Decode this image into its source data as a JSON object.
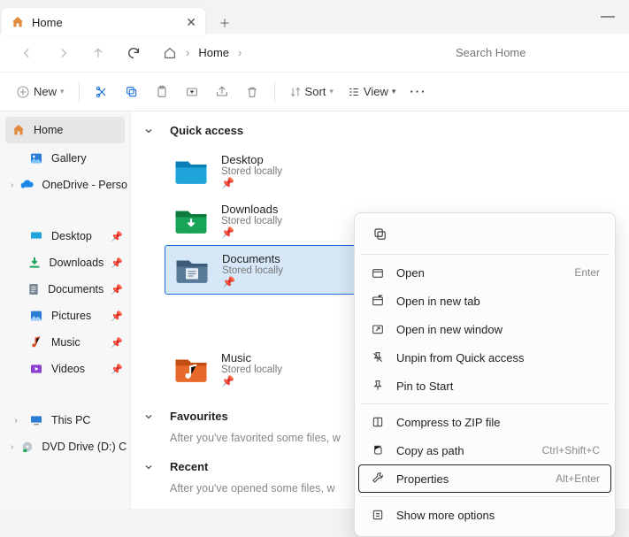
{
  "titlebar": {
    "tab_label": "Home"
  },
  "nav": {
    "breadcrumb": "Home",
    "search_placeholder": "Search Home"
  },
  "toolbar": {
    "new_label": "New",
    "sort_label": "Sort",
    "view_label": "View"
  },
  "sidebar": {
    "home": "Home",
    "gallery": "Gallery",
    "onedrive": "OneDrive - Perso",
    "desktop": "Desktop",
    "downloads": "Downloads",
    "documents": "Documents",
    "pictures": "Pictures",
    "music": "Music",
    "videos": "Videos",
    "thispc": "This PC",
    "dvd": "DVD Drive (D:) C"
  },
  "sections": {
    "quick_access": "Quick access",
    "favourites": "Favourites",
    "favourites_hint": "After you've favorited some files, w",
    "recent": "Recent",
    "recent_hint": "After you've opened some files, w"
  },
  "tiles": {
    "desktop": {
      "name": "Desktop",
      "sub": "Stored locally"
    },
    "downloads": {
      "name": "Downloads",
      "sub": "Stored locally"
    },
    "documents": {
      "name": "Documents",
      "sub": "Stored locally"
    },
    "music": {
      "name": "Music",
      "sub": "Stored locally"
    }
  },
  "ctx": {
    "open": "Open",
    "open_shortcut": "Enter",
    "open_new_tab": "Open in new tab",
    "open_new_window": "Open in new window",
    "unpin": "Unpin from Quick access",
    "pin_start": "Pin to Start",
    "compress": "Compress to ZIP file",
    "copy_path": "Copy as path",
    "copy_path_shortcut": "Ctrl+Shift+C",
    "properties": "Properties",
    "properties_shortcut": "Alt+Enter",
    "show_more": "Show more options"
  }
}
